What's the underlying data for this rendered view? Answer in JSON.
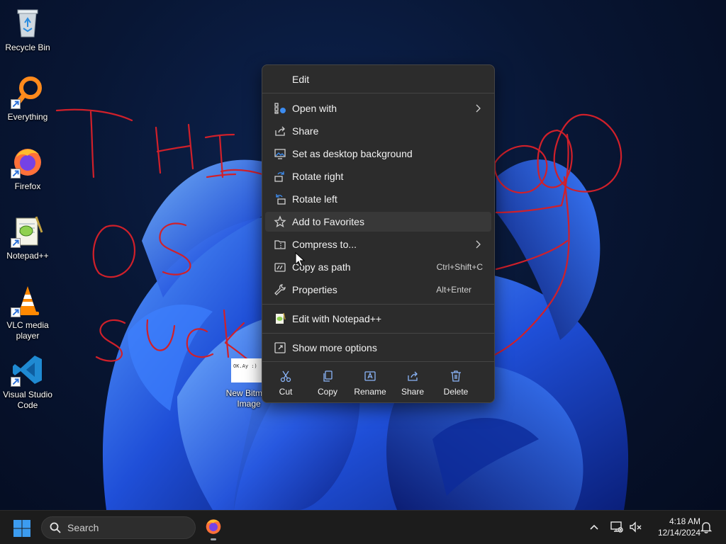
{
  "desktop": {
    "icons": [
      {
        "label": "Recycle Bin",
        "icon": "recycle-bin-icon"
      },
      {
        "label": "Everything",
        "icon": "everything-search-icon"
      },
      {
        "label": "Firefox",
        "icon": "firefox-icon"
      },
      {
        "label": "Notepad++",
        "icon": "notepad-plus-plus-icon"
      },
      {
        "label": "VLC media player",
        "icon": "vlc-cone-icon"
      },
      {
        "label": "Visual Studio Code",
        "icon": "vscode-icon"
      }
    ],
    "file": {
      "label": "New Bitmap Image",
      "thumbnail_text": "OK.Ay :)"
    }
  },
  "context_menu": {
    "items": [
      {
        "label": "Edit",
        "icon": "none"
      },
      {
        "label": "Open with",
        "icon": "open-with-icon",
        "submenu": true
      },
      {
        "label": "Share",
        "icon": "share-icon"
      },
      {
        "label": "Set as desktop background",
        "icon": "desktop-background-icon"
      },
      {
        "label": "Rotate right",
        "icon": "rotate-right-icon"
      },
      {
        "label": "Rotate left",
        "icon": "rotate-left-icon"
      },
      {
        "label": "Add to Favorites",
        "icon": "star-icon",
        "hovered": true
      },
      {
        "label": "Compress to...",
        "icon": "zip-folder-icon",
        "submenu": true
      },
      {
        "label": "Copy as path",
        "icon": "copy-path-icon",
        "shortcut": "Ctrl+Shift+C"
      },
      {
        "label": "Properties",
        "icon": "wrench-icon",
        "shortcut": "Alt+Enter"
      },
      {
        "label": "Edit with Notepad++",
        "icon": "notepad-plus-plus-icon"
      },
      {
        "label": "Show more options",
        "icon": "more-options-icon"
      }
    ],
    "actions": [
      {
        "label": "Cut",
        "icon": "scissors-icon"
      },
      {
        "label": "Copy",
        "icon": "copy-icon"
      },
      {
        "label": "Rename",
        "icon": "rename-icon"
      },
      {
        "label": "Share",
        "icon": "share-icon"
      },
      {
        "label": "Delete",
        "icon": "trash-icon"
      }
    ]
  },
  "taskbar": {
    "search_placeholder": "Search",
    "pinned_app": "Firefox",
    "clock": {
      "time": "4:18 AM",
      "date": "12/14/2024"
    }
  },
  "colors": {
    "menu_bg": "#2c2c2c",
    "taskbar_bg": "#1c1c1c",
    "scribble": "#d0202a",
    "accent": "#3c8cf0"
  }
}
